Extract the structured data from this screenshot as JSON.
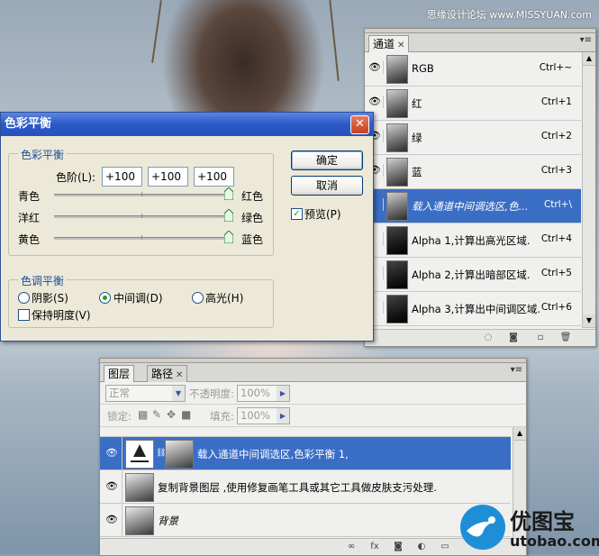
{
  "watermark_top": "思缘设计论坛  www.MISSYUAN.com",
  "channels": {
    "tab_label": "通道",
    "rows": [
      {
        "name": "RGB",
        "shortcut": "Ctrl+~",
        "eye": true,
        "selected": false,
        "italic": false
      },
      {
        "name": "红",
        "shortcut": "Ctrl+1",
        "eye": true,
        "selected": false,
        "italic": false
      },
      {
        "name": "绿",
        "shortcut": "Ctrl+2",
        "eye": true,
        "selected": false,
        "italic": false
      },
      {
        "name": "蓝",
        "shortcut": "Ctrl+3",
        "eye": true,
        "selected": false,
        "italic": false
      },
      {
        "name": "载入通道中间调选区,色...",
        "shortcut": "Ctrl+\\",
        "eye": false,
        "selected": true,
        "italic": true
      },
      {
        "name": "Alpha 1,计算出高光区域.",
        "shortcut": "Ctrl+4",
        "eye": false,
        "selected": false,
        "italic": false
      },
      {
        "name": "Alpha 2,计算出暗部区域.",
        "shortcut": "Ctrl+5",
        "eye": false,
        "selected": false,
        "italic": false
      },
      {
        "name": "Alpha 3,计算出中间调区域.",
        "shortcut": "Ctrl+6",
        "eye": false,
        "selected": false,
        "italic": false
      }
    ]
  },
  "dialog": {
    "title": "色彩平衡",
    "close_glyph": "✕",
    "color_balance_group": "色彩平衡",
    "levels_label": "色阶(L):",
    "levels": [
      "+100",
      "+100",
      "+100"
    ],
    "sliders": [
      {
        "left": "青色",
        "right": "红色",
        "value": 100
      },
      {
        "left": "洋红",
        "right": "绿色",
        "value": 100
      },
      {
        "left": "黄色",
        "right": "蓝色",
        "value": 100
      }
    ],
    "tone_group": "色调平衡",
    "tones": [
      {
        "label": "阴影(S)",
        "checked": false
      },
      {
        "label": "中间调(D)",
        "checked": true
      },
      {
        "label": "高光(H)",
        "checked": false
      }
    ],
    "preserve_label": "保持明度(V)",
    "preserve_checked": false,
    "ok_label": "确定",
    "cancel_label": "取消",
    "preview_label": "预览(P)",
    "preview_checked": true
  },
  "layers": {
    "tab_layers": "图层",
    "tab_paths": "路径",
    "blend_mode": "正常",
    "opacity_label": "不透明度:",
    "opacity_value": "100%",
    "lock_label": "锁定:",
    "fill_label": "填充:",
    "fill_value": "100%",
    "rows": [
      {
        "name": "载入通道中间调选区,色彩平衡 1,",
        "selected": true,
        "italic": false,
        "adjustment": true
      },
      {
        "name": "复制背景图层 ,使用修复画笔工具或其它工具做皮肤支污处理.",
        "selected": false,
        "italic": false,
        "adjustment": false
      },
      {
        "name": "背景",
        "selected": false,
        "italic": true,
        "adjustment": false
      }
    ]
  },
  "logo": {
    "text": "优图宝",
    "url_text": "utobao.com"
  },
  "colors": {
    "selection": "#3a6ec5",
    "dialog_title": "#2d59c7",
    "group_label": "#1b4d9a"
  }
}
